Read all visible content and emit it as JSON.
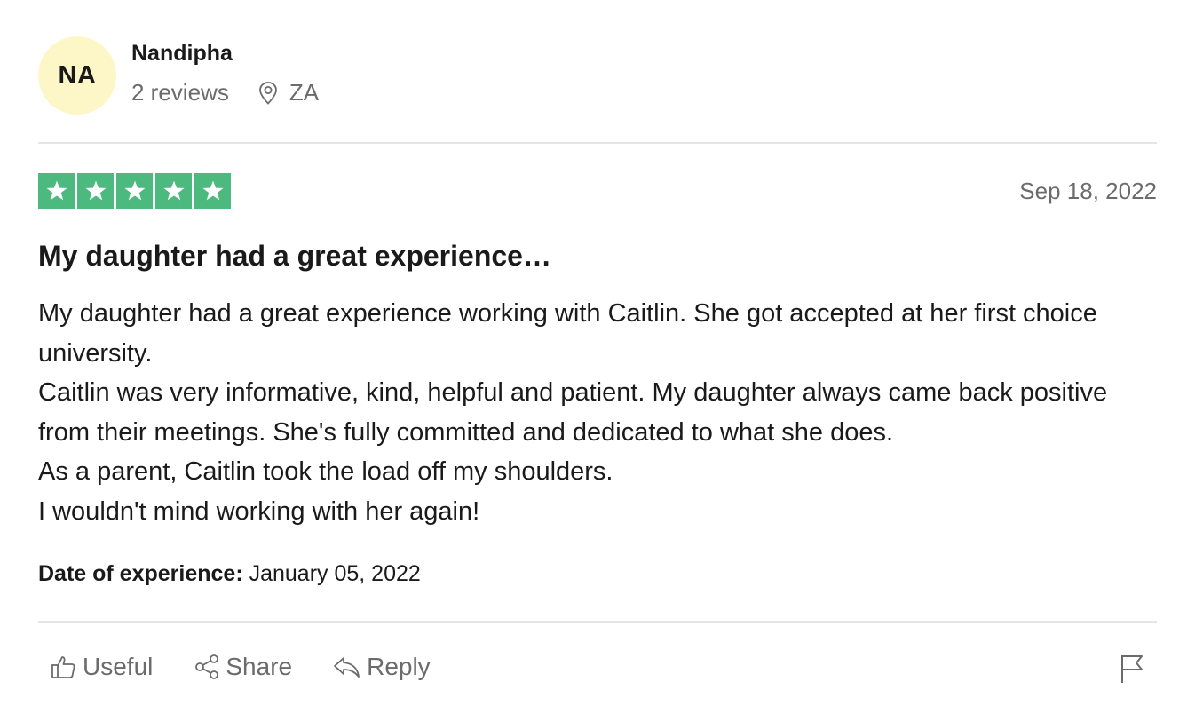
{
  "reviewer": {
    "initials": "NA",
    "name": "Nandipha",
    "reviews_count": "2 reviews",
    "location": "ZA",
    "avatar_color": "#fdf7c8"
  },
  "review": {
    "rating": 5,
    "max_rating": 5,
    "star_color": "#4cba7e",
    "date": "Sep 18, 2022",
    "title": "My daughter had a great experience…",
    "paragraphs": [
      "My daughter had a great experience working with Caitlin. She got accepted at her first choice university.",
      "Caitlin was very informative, kind, helpful and patient. My daughter always came back positive from their meetings. She's fully committed and dedicated to what she does.",
      "As a parent, Caitlin took the load off my shoulders.",
      "I wouldn't mind working with her again!"
    ],
    "experience_label": "Date of experience:",
    "experience_date": "January 05, 2022"
  },
  "actions": {
    "useful_label": "Useful",
    "share_label": "Share",
    "reply_label": "Reply"
  },
  "icons": {
    "location": "location-pin-icon",
    "useful": "thumbs-up-icon",
    "share": "share-icon",
    "reply": "reply-icon",
    "flag": "flag-icon"
  }
}
